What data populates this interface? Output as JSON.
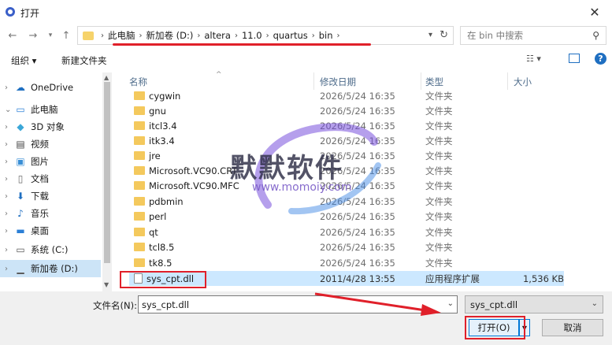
{
  "window": {
    "title": "打开"
  },
  "nav": {
    "breadcrumbs": [
      "此电脑",
      "新加卷 (D:)",
      "altera",
      "11.0",
      "quartus",
      "bin"
    ],
    "search_placeholder": "在 bin 中搜索"
  },
  "toolbar": {
    "organize": "组织 ▾",
    "new_folder": "新建文件夹"
  },
  "sidebar": {
    "items": [
      {
        "label": "OneDrive",
        "icon": "cloud-icon"
      },
      {
        "label": "此电脑",
        "icon": "computer-icon"
      },
      {
        "label": "3D 对象",
        "icon": "cube-icon"
      },
      {
        "label": "视频",
        "icon": "video-icon"
      },
      {
        "label": "图片",
        "icon": "picture-icon"
      },
      {
        "label": "文档",
        "icon": "document-icon"
      },
      {
        "label": "下载",
        "icon": "download-icon"
      },
      {
        "label": "音乐",
        "icon": "music-icon"
      },
      {
        "label": "桌面",
        "icon": "desktop-icon"
      },
      {
        "label": "系统 (C:)",
        "icon": "drive-icon"
      },
      {
        "label": "新加卷 (D:)",
        "icon": "drive-icon"
      }
    ]
  },
  "columns": {
    "name": "名称",
    "modified": "修改日期",
    "type": "类型",
    "size": "大小"
  },
  "files": [
    {
      "name": "cygwin",
      "modified": "2026/5/24 16:35",
      "type": "文件夹",
      "size": ""
    },
    {
      "name": "gnu",
      "modified": "2026/5/24 16:35",
      "type": "文件夹",
      "size": ""
    },
    {
      "name": "itcl3.4",
      "modified": "2026/5/24 16:35",
      "type": "文件夹",
      "size": ""
    },
    {
      "name": "itk3.4",
      "modified": "2026/5/24 16:35",
      "type": "文件夹",
      "size": ""
    },
    {
      "name": "jre",
      "modified": "2026/5/24 16:35",
      "type": "文件夹",
      "size": ""
    },
    {
      "name": "Microsoft.VC90.CRT",
      "modified": "2026/5/24 16:35",
      "type": "文件夹",
      "size": ""
    },
    {
      "name": "Microsoft.VC90.MFC",
      "modified": "2026/5/24 16:35",
      "type": "文件夹",
      "size": ""
    },
    {
      "name": "pdbmin",
      "modified": "2026/5/24 16:35",
      "type": "文件夹",
      "size": ""
    },
    {
      "name": "perl",
      "modified": "2026/5/24 16:35",
      "type": "文件夹",
      "size": ""
    },
    {
      "name": "qt",
      "modified": "2026/5/24 16:35",
      "type": "文件夹",
      "size": ""
    },
    {
      "name": "tcl8.5",
      "modified": "2026/5/24 16:35",
      "type": "文件夹",
      "size": ""
    },
    {
      "name": "tk8.5",
      "modified": "2026/5/24 16:35",
      "type": "文件夹",
      "size": ""
    },
    {
      "name": "sys_cpt.dll",
      "modified": "2011/4/28 13:55",
      "type": "应用程序扩展",
      "size": "1,536 KB"
    }
  ],
  "watermark": {
    "text": "默默软件",
    "url": "www.momoiy.com"
  },
  "footer": {
    "filename_label": "文件名(N):",
    "filename_value": "sys_cpt.dll",
    "filter_value": "sys_cpt.dll",
    "open_label": "打开(O)",
    "cancel_label": "取消"
  },
  "colors": {
    "accent": "#0078d7",
    "highlight_red": "#e0202a",
    "selection": "#cce8ff"
  }
}
